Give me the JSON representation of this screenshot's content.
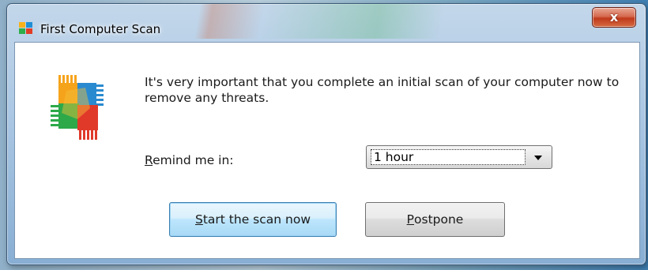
{
  "window": {
    "title": "First Computer Scan",
    "close_label": "x",
    "app_icon": "avg-logo-icon"
  },
  "message": "It's very important that you complete an initial scan of your computer now to remove any threats.",
  "remind": {
    "label_accel": "R",
    "label_rest": "emind me in:",
    "selected": "1 hour"
  },
  "buttons": {
    "scan_accel": "S",
    "scan_rest": "tart the scan now",
    "postpone_accel": "P",
    "postpone_rest": "ostpone"
  },
  "colors": {
    "title_bar": "#a9c6e3",
    "close_button": "#c03a1c",
    "primary_button": "#bee6fd"
  }
}
